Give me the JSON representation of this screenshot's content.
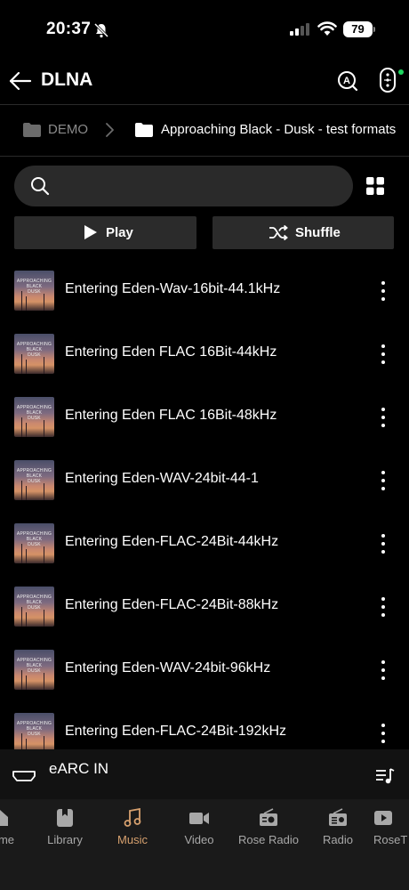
{
  "status_bar": {
    "time": "20:37",
    "battery": "79"
  },
  "header": {
    "title": "DLNA"
  },
  "breadcrumb": {
    "parent": "DEMO",
    "current": "Approaching Black - Dusk - test formats"
  },
  "search": {
    "placeholder": ""
  },
  "actions": {
    "play_label": "Play",
    "shuffle_label": "Shuffle"
  },
  "album_art": {
    "line1": "APPROACHING",
    "line2": "BLACK",
    "line3": "DUSK"
  },
  "tracks": [
    {
      "title": "Entering Eden-Wav-16bit-44.1kHz"
    },
    {
      "title": "Entering Eden FLAC 16Bit-44kHz"
    },
    {
      "title": "Entering Eden FLAC 16Bit-48kHz"
    },
    {
      "title": "Entering Eden-WAV-24bit-44-1"
    },
    {
      "title": "Entering Eden-FLAC-24Bit-44kHz"
    },
    {
      "title": "Entering Eden-FLAC-24Bit-88kHz"
    },
    {
      "title": "Entering Eden-WAV-24bit-96kHz"
    },
    {
      "title": "Entering Eden-FLAC-24Bit-192kHz"
    }
  ],
  "mini_player": {
    "source": "eARC IN"
  },
  "nav": [
    {
      "label": "me",
      "icon": "home-icon"
    },
    {
      "label": "Library",
      "icon": "library-icon"
    },
    {
      "label": "Music",
      "icon": "music-icon",
      "active": true
    },
    {
      "label": "Video",
      "icon": "video-icon"
    },
    {
      "label": "Rose Radio",
      "icon": "rose-radio-icon"
    },
    {
      "label": "Radio",
      "icon": "radio-icon"
    },
    {
      "label": "RoseT",
      "icon": "rosetube-icon"
    }
  ],
  "colors": {
    "accent": "#d6a06e",
    "background": "#000000",
    "surface": "#2b2b2b",
    "online_dot": "#1ed760"
  }
}
